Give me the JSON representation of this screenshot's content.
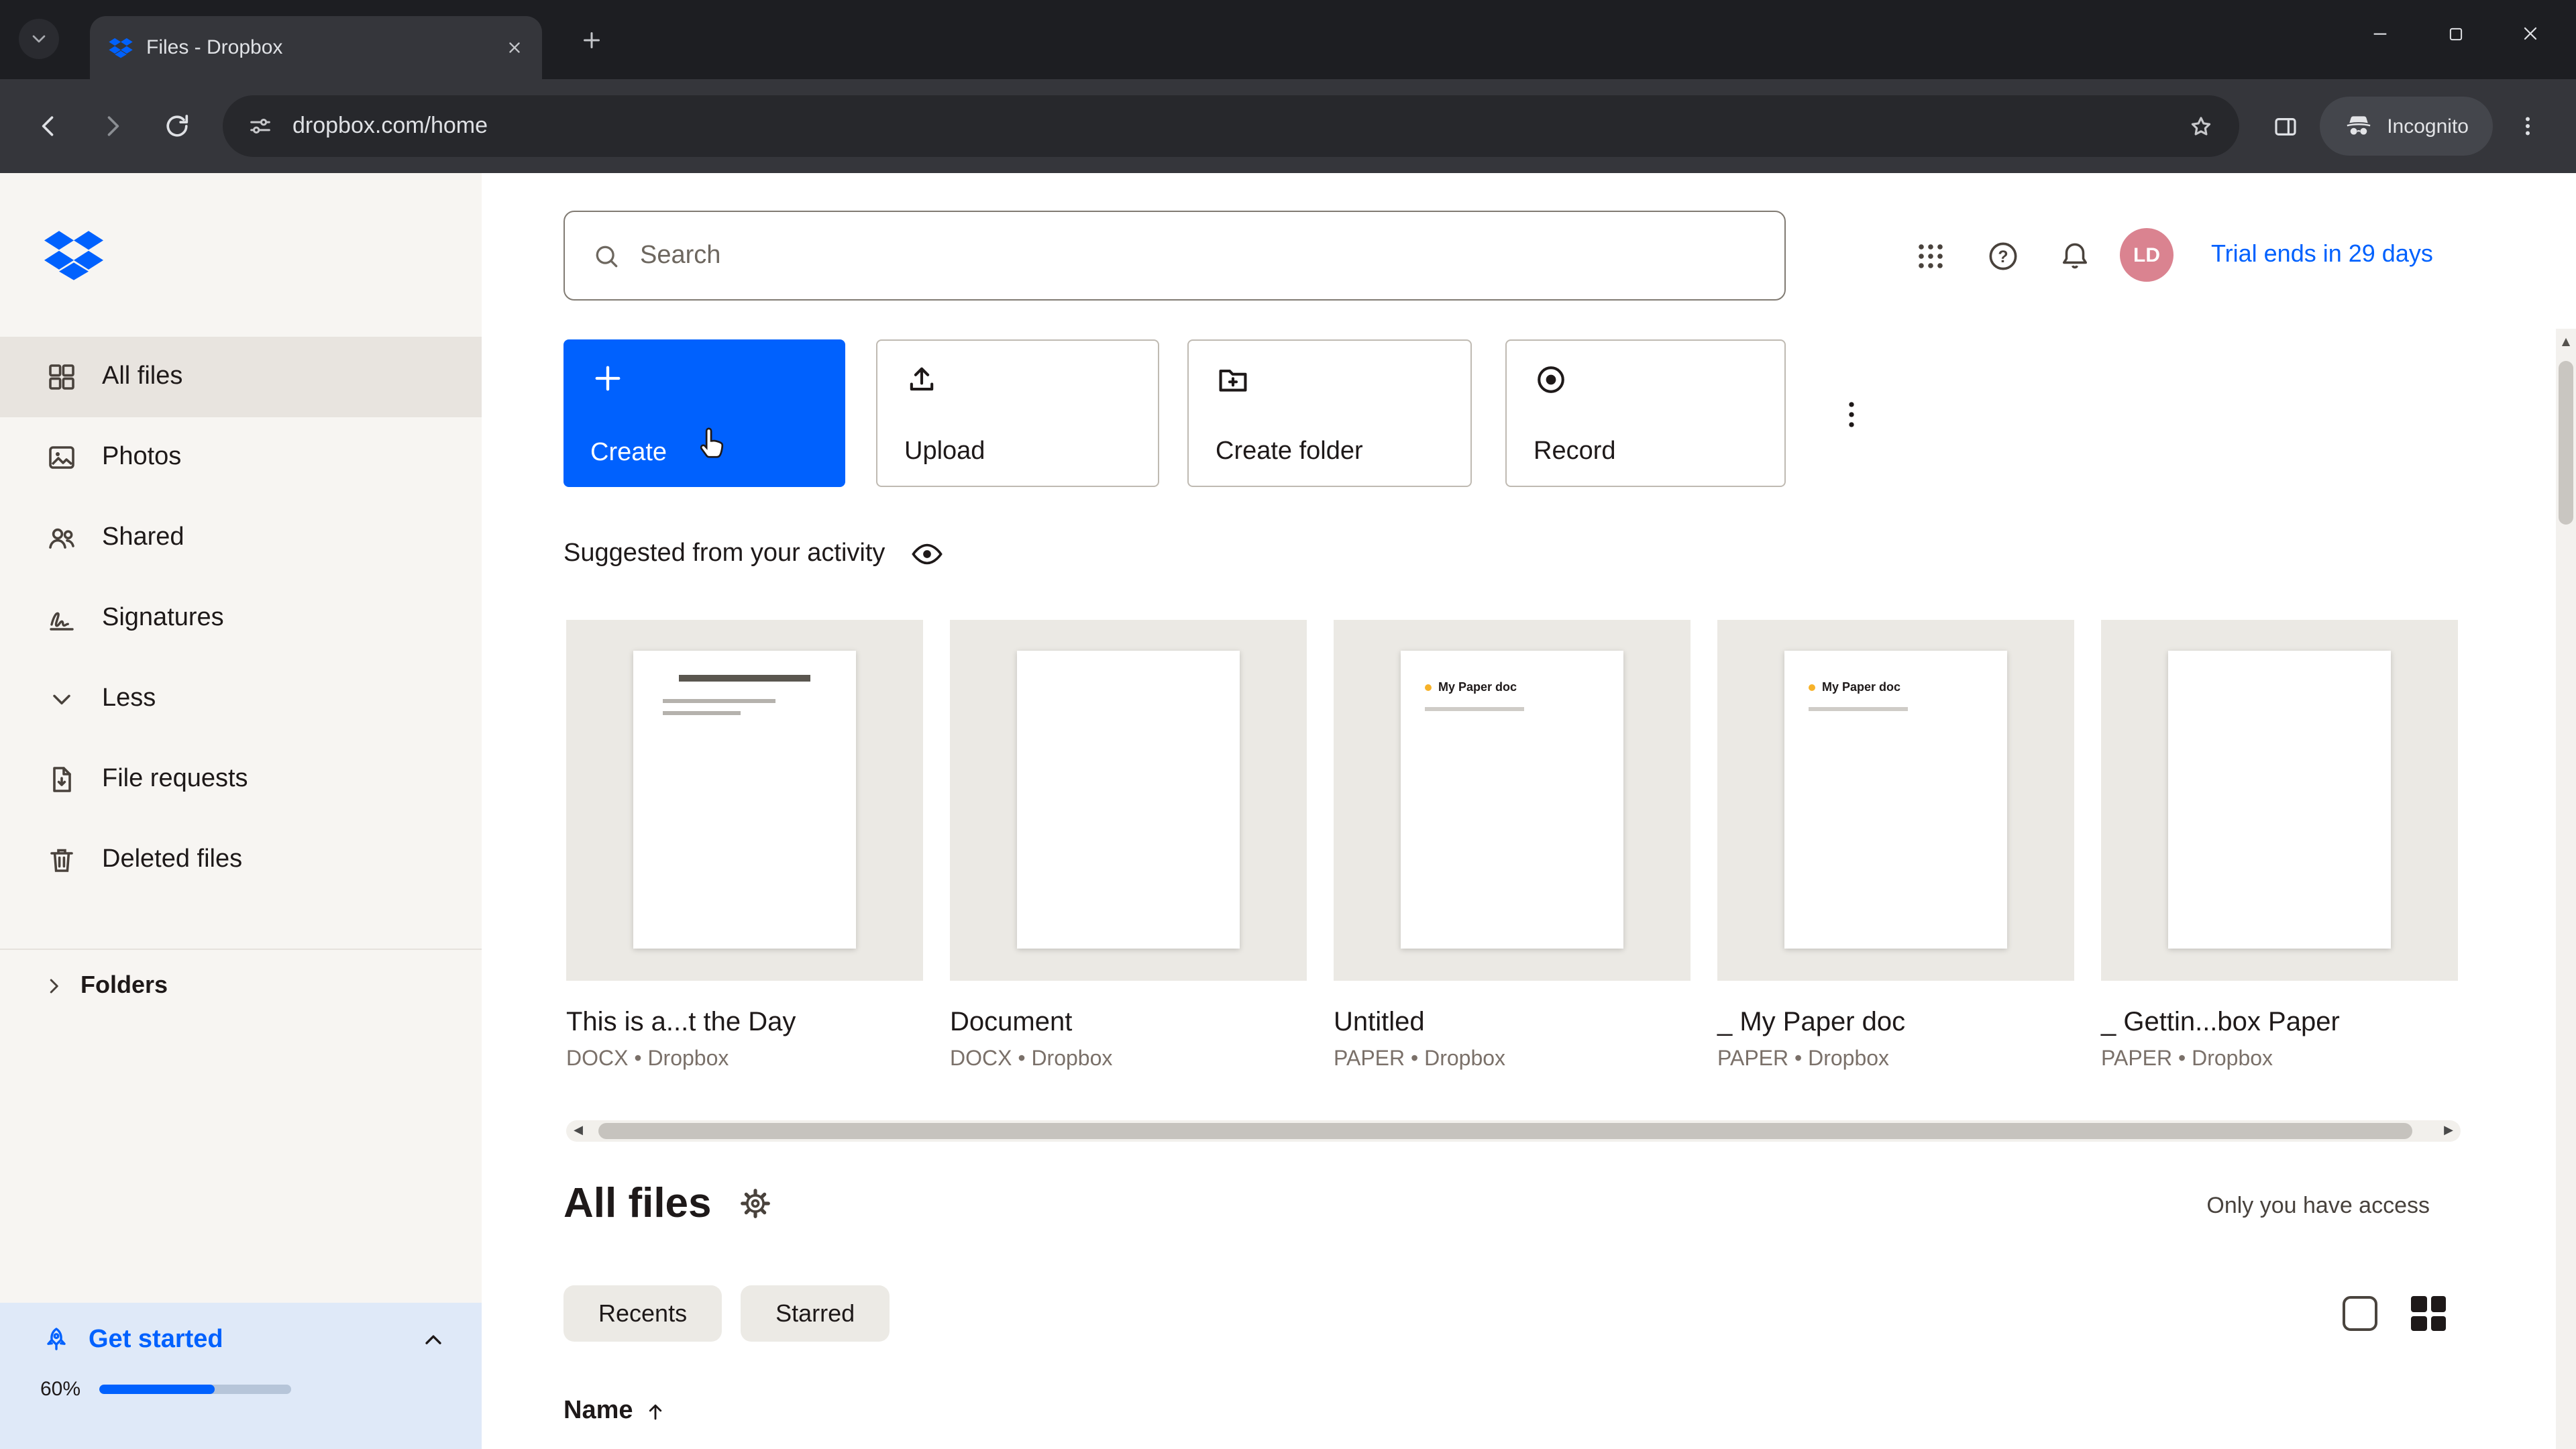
{
  "browser": {
    "tab_title": "Files - Dropbox",
    "url": "dropbox.com/home",
    "incognito_label": "Incognito"
  },
  "topbar": {
    "search_placeholder": "Search",
    "avatar_initials": "LD",
    "trial_text": "Trial ends in 29 days"
  },
  "sidebar": {
    "items": [
      {
        "label": "All files"
      },
      {
        "label": "Photos"
      },
      {
        "label": "Shared"
      },
      {
        "label": "Signatures"
      },
      {
        "label": "Less"
      },
      {
        "label": "File requests"
      },
      {
        "label": "Deleted files"
      }
    ],
    "folders_label": "Folders",
    "get_started": {
      "label": "Get started",
      "percent_label": "60%",
      "percent": 60
    }
  },
  "actions": {
    "create_label": "Create",
    "upload_label": "Upload",
    "create_folder_label": "Create folder",
    "record_label": "Record"
  },
  "suggested": {
    "heading": "Suggested from your activity",
    "cards": [
      {
        "title": "This is a...t the Day",
        "meta": "DOCX • Dropbox"
      },
      {
        "title": "Document",
        "meta": "DOCX • Dropbox"
      },
      {
        "title": "Untitled",
        "meta": "PAPER • Dropbox",
        "thumb_title": "My Paper doc"
      },
      {
        "title": "_ My Paper doc",
        "meta": "PAPER • Dropbox",
        "thumb_title": "My Paper doc"
      },
      {
        "title": "_ Gettin...box Paper",
        "meta": "PAPER • Dropbox"
      }
    ]
  },
  "files": {
    "heading": "All files",
    "access_text": "Only you have access",
    "filters": [
      {
        "label": "Recents"
      },
      {
        "label": "Starred"
      }
    ],
    "name_header": "Name"
  },
  "colors": {
    "accent": "#0061fe"
  }
}
